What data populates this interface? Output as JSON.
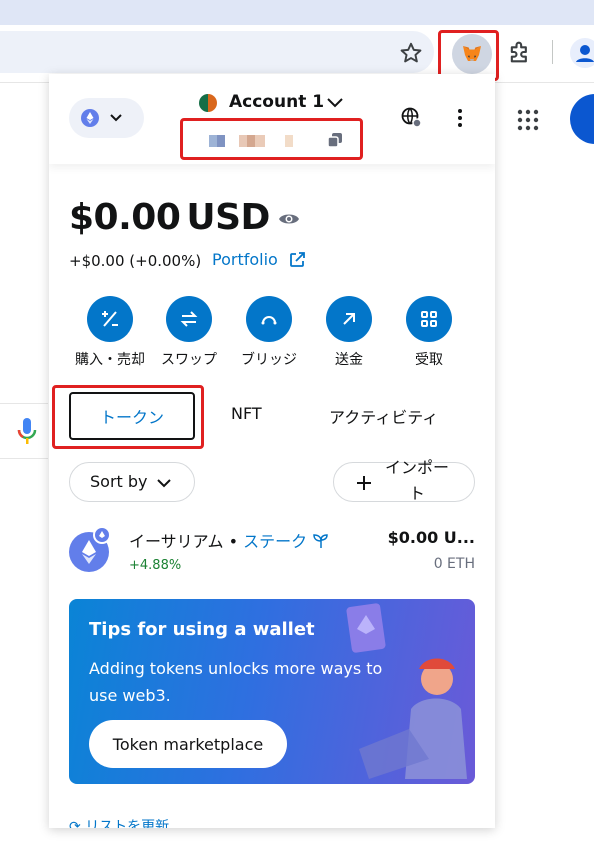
{
  "browser": {
    "omnibox_placeholder": "",
    "icons": [
      "star-icon",
      "metamask-fox-icon",
      "puzzle-icon",
      "profile-icon",
      "apps-grid-icon",
      "mic-icon"
    ]
  },
  "header": {
    "account_name": "Account 1",
    "network": "ethereum"
  },
  "balance": {
    "amount": "$0.00",
    "currency": "USD",
    "change": "+$0.00 (+0.00%)",
    "portfolio_label": "Portfolio"
  },
  "actions": [
    {
      "label": "購入・売却",
      "icon": "buy-sell-icon"
    },
    {
      "label": "スワップ",
      "icon": "swap-icon"
    },
    {
      "label": "ブリッジ",
      "icon": "bridge-icon"
    },
    {
      "label": "送金",
      "icon": "send-icon"
    },
    {
      "label": "受取",
      "icon": "receive-icon"
    }
  ],
  "tabs": {
    "tokens": "トークン",
    "nft": "NFT",
    "activity": "アクティビティ"
  },
  "controls": {
    "sort_label": "Sort by",
    "import_label_line1": "インポー",
    "import_label_line2": "ト"
  },
  "token": {
    "name": "イーサリアム",
    "separator": " • ",
    "stake_label": "ステーク",
    "change": "+4.88%",
    "fiat": "$0.00 U...",
    "amount": "0 ETH"
  },
  "tips": {
    "title": "Tips for using a wallet",
    "body": "Adding tokens unlocks more ways to use web3.",
    "button": "Token marketplace"
  },
  "footer": {
    "refresh_label": "リストを更新"
  },
  "colors": {
    "accent": "#0376c9",
    "highlight": "#e02020",
    "positive": "#1c8234"
  }
}
